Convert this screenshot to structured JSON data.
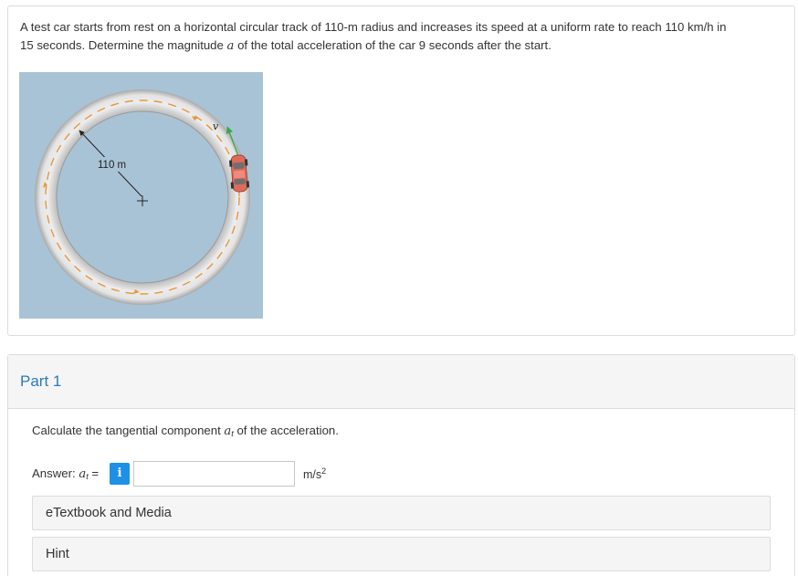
{
  "problem": {
    "text_line1": "A test car starts from rest on a horizontal circular track of 110-m radius and increases its speed at a uniform rate to reach 110 km/h in",
    "text_line2_pre": "15 seconds. Determine the magnitude ",
    "text_line2_var": "a",
    "text_line2_post": " of the total acceleration of the car 9 seconds after the start."
  },
  "figure": {
    "radius_label": "110 m",
    "velocity_label": "v",
    "colors": {
      "background": "#a9c3d6",
      "track": "#e3e3e3",
      "inner_field": "#a9c3d6",
      "dashes": "#e8963c",
      "velocity_arrow": "#3aa84a",
      "car": "#e06a5a"
    }
  },
  "part": {
    "title": "Part 1",
    "question_pre": "Calculate the tangential component ",
    "question_var": "a",
    "question_sub": "t",
    "question_post": " of the acceleration.",
    "answer_label_pre": "Answer: ",
    "answer_var": "a",
    "answer_sub": "t",
    "answer_eq": " =",
    "info_icon_glyph": "i",
    "answer_value": "",
    "unit_base": "m/s",
    "unit_exp": "2",
    "etextbook_label": "eTextbook and Media",
    "hint_label": "Hint",
    "accent_color": "#2a7ab8",
    "info_button_color": "#1e90e6"
  }
}
